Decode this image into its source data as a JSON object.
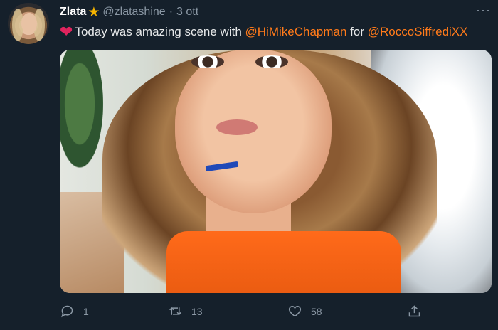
{
  "tweet": {
    "author_name": "Zlata",
    "verified_icon": "star-icon",
    "handle": "@zlatashine",
    "separator": "·",
    "time": "3 ott",
    "more_label": "···",
    "text": {
      "emoji_icon": "red-heart-icon",
      "part1": "Today was amazing scene with",
      "mention1": "@HiMikeChapman",
      "part2": "for",
      "mention2": "@RoccoSiffrediXX"
    },
    "media_alt": "Photo",
    "actions": {
      "reply_count": "1",
      "retweet_count": "13",
      "like_count": "58"
    },
    "colors": {
      "background": "#15202b",
      "mention": "#ff7a1a",
      "muted": "#8b98a5",
      "heart": "#e0245e",
      "star": "#f5b400"
    }
  }
}
